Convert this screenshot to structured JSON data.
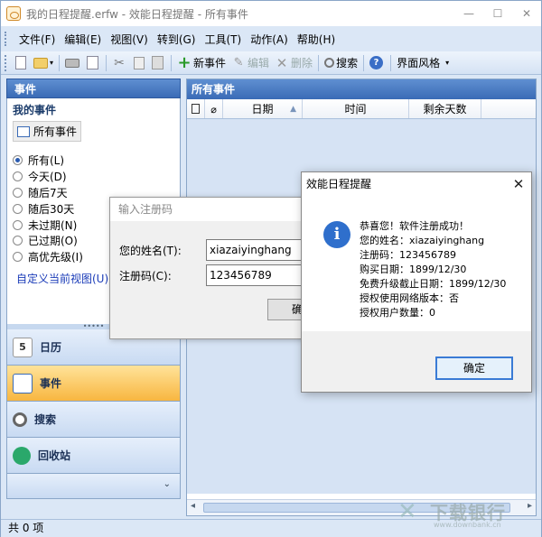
{
  "window": {
    "title": "我的日程提醒.erfw - 效能日程提醒 - 所有事件",
    "min": "—",
    "max": "☐",
    "close": "✕"
  },
  "menu": [
    "文件(F)",
    "编辑(E)",
    "视图(V)",
    "转到(G)",
    "工具(T)",
    "动作(A)",
    "帮助(H)"
  ],
  "toolbar": {
    "new_event": "新事件",
    "edit": "编辑",
    "delete": "删除",
    "search": "搜索",
    "style": "界面风格"
  },
  "left_panel": {
    "header": "事件",
    "my_events": "我的事件",
    "all_events": "所有事件",
    "filters": [
      "所有(L)",
      "今天(D)",
      "随后7天",
      "随后30天",
      "未过期(N)",
      "已过期(O)",
      "高优先级(I)"
    ],
    "selected_filter": "所有(L)",
    "custom_view": "自定义当前视图(U)...",
    "nav": [
      "日历",
      "事件",
      "搜索",
      "回收站"
    ],
    "active_nav": "事件",
    "splitter_dots": "•••••",
    "footer_arrow": "⌄"
  },
  "main_panel": {
    "header": "所有事件",
    "columns": [
      "",
      "",
      "日期",
      "时间",
      "剩余天数"
    ]
  },
  "status": "共 0 项",
  "register_dialog": {
    "title": "输入注册码",
    "name_label": "您的姓名(T):",
    "name_value": "xiazaiyinghang",
    "code_label": "注册码(C):",
    "code_value": "123456789",
    "ok": "确"
  },
  "message_dialog": {
    "title": "效能日程提醒",
    "icon": "i",
    "lines": [
      "恭喜您！软件注册成功！",
      "您的姓名：xiazaiyinghang",
      "注册码：123456789",
      "购买日期：1899/12/30",
      "免费升级截止日期：1899/12/30",
      "授权使用网络版本：否",
      "授权用户数量：0"
    ],
    "ok": "确定"
  },
  "watermark": {
    "text": "下载银行",
    "url": "www.downbank.cn"
  },
  "colors": {
    "header_blue": "#3a6bb6",
    "active_nav": "#f8b640",
    "link": "#1a3bb8"
  }
}
